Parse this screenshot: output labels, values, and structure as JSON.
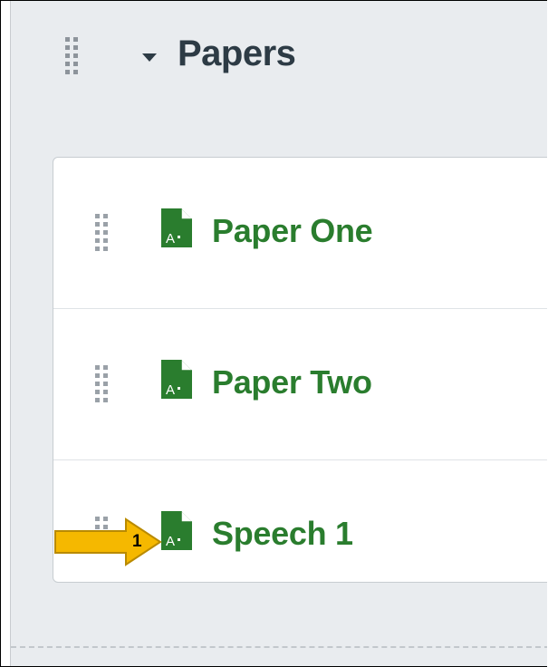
{
  "module": {
    "title": "Papers",
    "expanded": true,
    "icons": {
      "drag_handle": "drag-handle-icon",
      "collapse": "caret-down-icon"
    }
  },
  "items": [
    {
      "label": "Paper One",
      "icon": "assignment-document-icon",
      "color": "#2a7d2e"
    },
    {
      "label": "Paper Two",
      "icon": "assignment-document-icon",
      "color": "#2a7d2e"
    },
    {
      "label": "Speech 1",
      "icon": "assignment-document-icon",
      "color": "#2a7d2e"
    }
  ],
  "callout": {
    "number": "1",
    "color": "#f5b800"
  }
}
